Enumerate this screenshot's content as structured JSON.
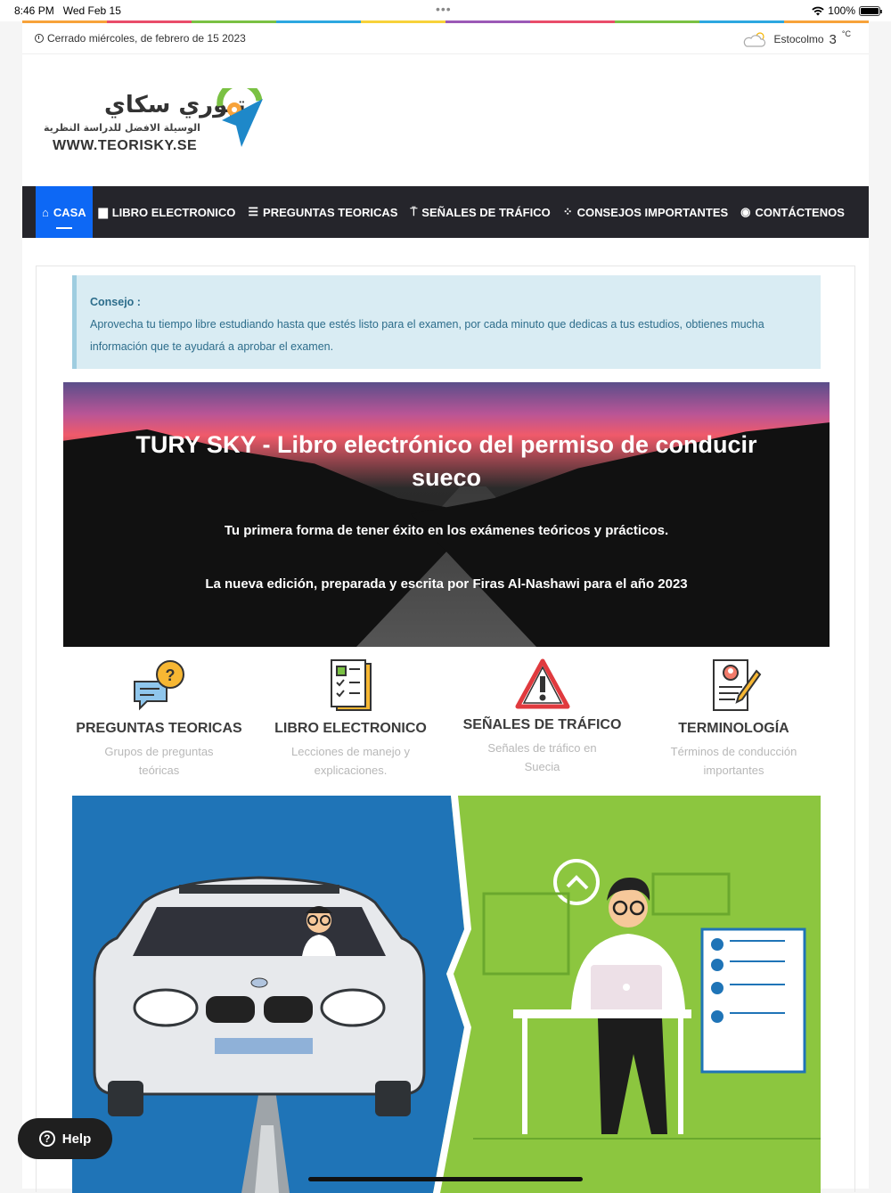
{
  "status_bar": {
    "time": "8:46 PM",
    "date": "Wed Feb 15",
    "battery": "100%"
  },
  "topbar": {
    "date_text": "Cerrado miércoles, de febrero de 15 2023",
    "city": "Estocolmo",
    "temperature": "3",
    "unit": "°C"
  },
  "logo": {
    "arabic_name": "تيوري سكاي",
    "arabic_tagline": "الوسيلة الافضل للدراسة النظرية",
    "url": "WWW.TEORISKY.SE"
  },
  "nav": {
    "items": [
      {
        "label": "CASA",
        "icon": "home-icon",
        "active": true
      },
      {
        "label": "LIBRO ELECTRONICO",
        "icon": "book-icon"
      },
      {
        "label": "PREGUNTAS TEORICAS",
        "icon": "list-icon"
      },
      {
        "label": "SEÑALES DE TRÁFICO",
        "icon": "signpost-icon"
      },
      {
        "label": "CONSEJOS IMPORTANTES",
        "icon": "tips-icon"
      },
      {
        "label": "CONTÁCTENOS",
        "icon": "messenger-icon"
      }
    ]
  },
  "tip": {
    "title": "Consejo :",
    "text": "Aprovecha tu tiempo libre estudiando hasta que estés listo para el examen, por cada minuto que dedicas a tus estudios, obtienes mucha información que te ayudará a aprobar el examen."
  },
  "hero": {
    "title": "TURY SKY - Libro electrónico del permiso de conducir sueco",
    "subtitle": "Tu primera forma de tener éxito en los exámenes teóricos y prácticos.",
    "edition": "La nueva edición, preparada y escrita por Firas Al-Nashawi para el año 2023"
  },
  "features": [
    {
      "title": "PREGUNTAS TEORICAS",
      "subtitle": "Grupos de preguntas teóricas",
      "icon": "question-chat-icon"
    },
    {
      "title": "LIBRO ELECTRONICO",
      "subtitle": "Lecciones de manejo y explicaciones.",
      "icon": "document-checklist-icon"
    },
    {
      "title": "SEÑALES DE TRÁFICO",
      "subtitle": "Señales de tráfico en Suecia",
      "icon": "warning-sign-icon"
    },
    {
      "title": "TERMINOLOGÍA",
      "subtitle": "Términos de conducción importantes",
      "icon": "profile-document-icon"
    }
  ],
  "help_button": {
    "label": "Help"
  },
  "colors": {
    "nav_bg": "#25252b",
    "nav_active": "#0d68f5",
    "tip_bg": "#d9ecf3",
    "tip_text": "#2d6d8b",
    "illus_blue": "#1f74b7",
    "illus_green": "#8cc63f"
  }
}
